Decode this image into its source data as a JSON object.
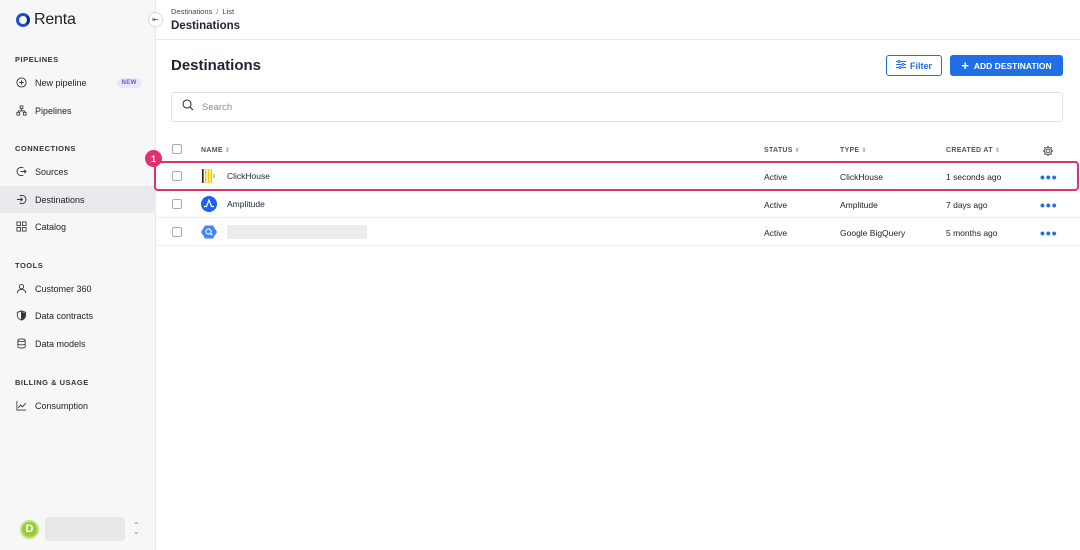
{
  "app": {
    "name": "Renta"
  },
  "sidebar": {
    "sections": [
      {
        "title": "PIPELINES",
        "items": [
          {
            "label": "New pipeline",
            "icon": "plus-circle-icon",
            "badge": "NEW"
          },
          {
            "label": "Pipelines",
            "icon": "hierarchy-icon"
          }
        ]
      },
      {
        "title": "CONNECTIONS",
        "items": [
          {
            "label": "Sources",
            "icon": "arrow-out-circle-icon"
          },
          {
            "label": "Destinations",
            "icon": "arrow-in-circle-icon",
            "active": true
          },
          {
            "label": "Catalog",
            "icon": "grid-icon"
          }
        ]
      },
      {
        "title": "TOOLS",
        "items": [
          {
            "label": "Customer 360",
            "icon": "user-icon"
          },
          {
            "label": "Data contracts",
            "icon": "shield-icon"
          },
          {
            "label": "Data models",
            "icon": "database-icon"
          }
        ]
      },
      {
        "title": "BILLING & USAGE",
        "items": [
          {
            "label": "Consumption",
            "icon": "trend-chart-icon"
          }
        ]
      }
    ],
    "user": {
      "initial": "D"
    }
  },
  "header": {
    "breadcrumb": [
      "Destinations",
      "List"
    ],
    "title": "Destinations"
  },
  "main": {
    "title": "Destinations",
    "filter_label": "Filter",
    "add_label": "ADD DESTINATION",
    "search_placeholder": "Search",
    "columns": {
      "name": "NAME",
      "status": "STATUS",
      "type": "TYPE",
      "created": "CREATED AT"
    },
    "rows": [
      {
        "name": "ClickHouse",
        "status": "Active",
        "type": "ClickHouse",
        "created": "1 seconds ago",
        "icon": "clickhouse-icon"
      },
      {
        "name": "Amplitude",
        "status": "Active",
        "type": "Amplitude",
        "created": "7 days ago",
        "icon": "amplitude-icon"
      },
      {
        "name": "",
        "status": "Active",
        "type": "Google BigQuery",
        "created": "5 months ago",
        "icon": "bigquery-icon"
      }
    ],
    "highlight_marker": "1"
  },
  "colors": {
    "accent": "#1f6fe5",
    "highlight": "#e0306e",
    "active_nav": "#e9eaed"
  }
}
